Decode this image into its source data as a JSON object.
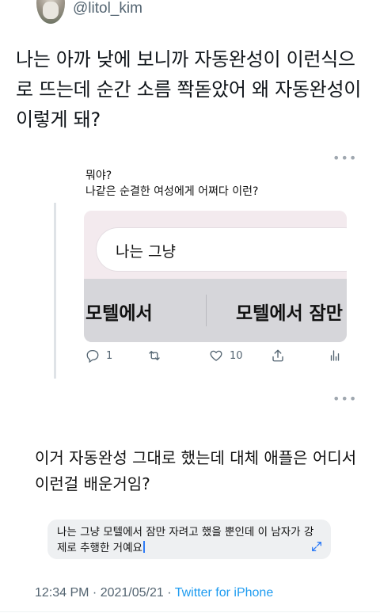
{
  "author": {
    "handle": "@litol_kim"
  },
  "tweet": {
    "text": "나는 아까 낮에 보니까 자동완성이 이런식으로 뜨는데 순간 소름 쫙돋았어 왜 자동완성이 이렇게 돼?"
  },
  "quote": {
    "line1": "뭐야?",
    "line2": "나같은 순결한 여성에게 어쩌다 이런?"
  },
  "keyboard_card": {
    "input_value": "나는 그냥",
    "suggestions": [
      "모텔에서",
      "모텔에서 잠만"
    ]
  },
  "quote_actions": {
    "reply_count": "1",
    "retweet_count": "",
    "like_count": "10"
  },
  "body": {
    "text": "이거 자동완성 그대로 했는데 대체 애플은 어디서 이런걸 배운거임?"
  },
  "note": {
    "text": "나는 그냥 모텔에서 잠만 자려고 했을 뿐인데 이 남자가 강제로 추행한 거예요"
  },
  "meta": {
    "time": "12:34 PM",
    "separator": " · ",
    "date": "2021/05/21",
    "source": "Twitter for iPhone"
  },
  "icons": {
    "more": "more-dots-icon",
    "reply": "reply-icon",
    "retweet": "retweet-icon",
    "like": "heart-icon",
    "share": "share-icon",
    "analytics": "analytics-icon",
    "expand": "expand-icon"
  },
  "colors": {
    "link": "#1d9bf0",
    "secondary": "#536471",
    "cursor": "#2f7cf6"
  }
}
